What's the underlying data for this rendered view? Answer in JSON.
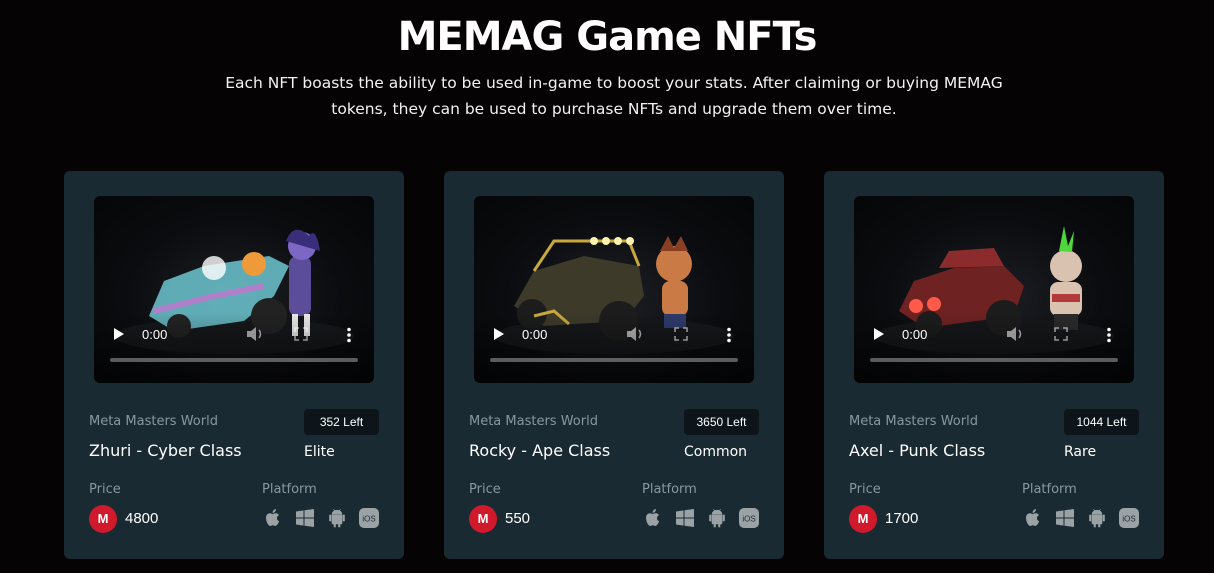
{
  "header": {
    "title": "MEMAG Game NFTs",
    "subtitle": "Each NFT boasts the ability to be used in-game to boost your stats. After claiming or buying MEMAG tokens, they can be used to purchase NFTs and upgrade them over time."
  },
  "labels": {
    "price": "Price",
    "platform": "Platform",
    "coin": "M"
  },
  "cards": [
    {
      "video_time": "0:00",
      "world": "Meta Masters World",
      "left": "352 Left",
      "name": "Zhuri - Cyber Class",
      "rarity": "Elite",
      "price": "4800",
      "accent": "#5fc4cf"
    },
    {
      "video_time": "0:00",
      "world": "Meta Masters World",
      "left": "3650 Left",
      "name": "Rocky - Ape Class",
      "rarity": "Common",
      "price": "550",
      "accent": "#b8a040"
    },
    {
      "video_time": "0:00",
      "world": "Meta Masters World",
      "left": "1044 Left",
      "name": "Axel - Punk Class",
      "rarity": "Rare",
      "price": "1700",
      "accent": "#b23a3a"
    }
  ],
  "platforms": [
    "apple-icon",
    "windows-icon",
    "android-icon",
    "ios-icon"
  ],
  "colors": {
    "background": "#050304",
    "card": "#1a2a33",
    "badge": "#0d151a",
    "coin": "#d0192b",
    "muted": "#8a979e"
  }
}
